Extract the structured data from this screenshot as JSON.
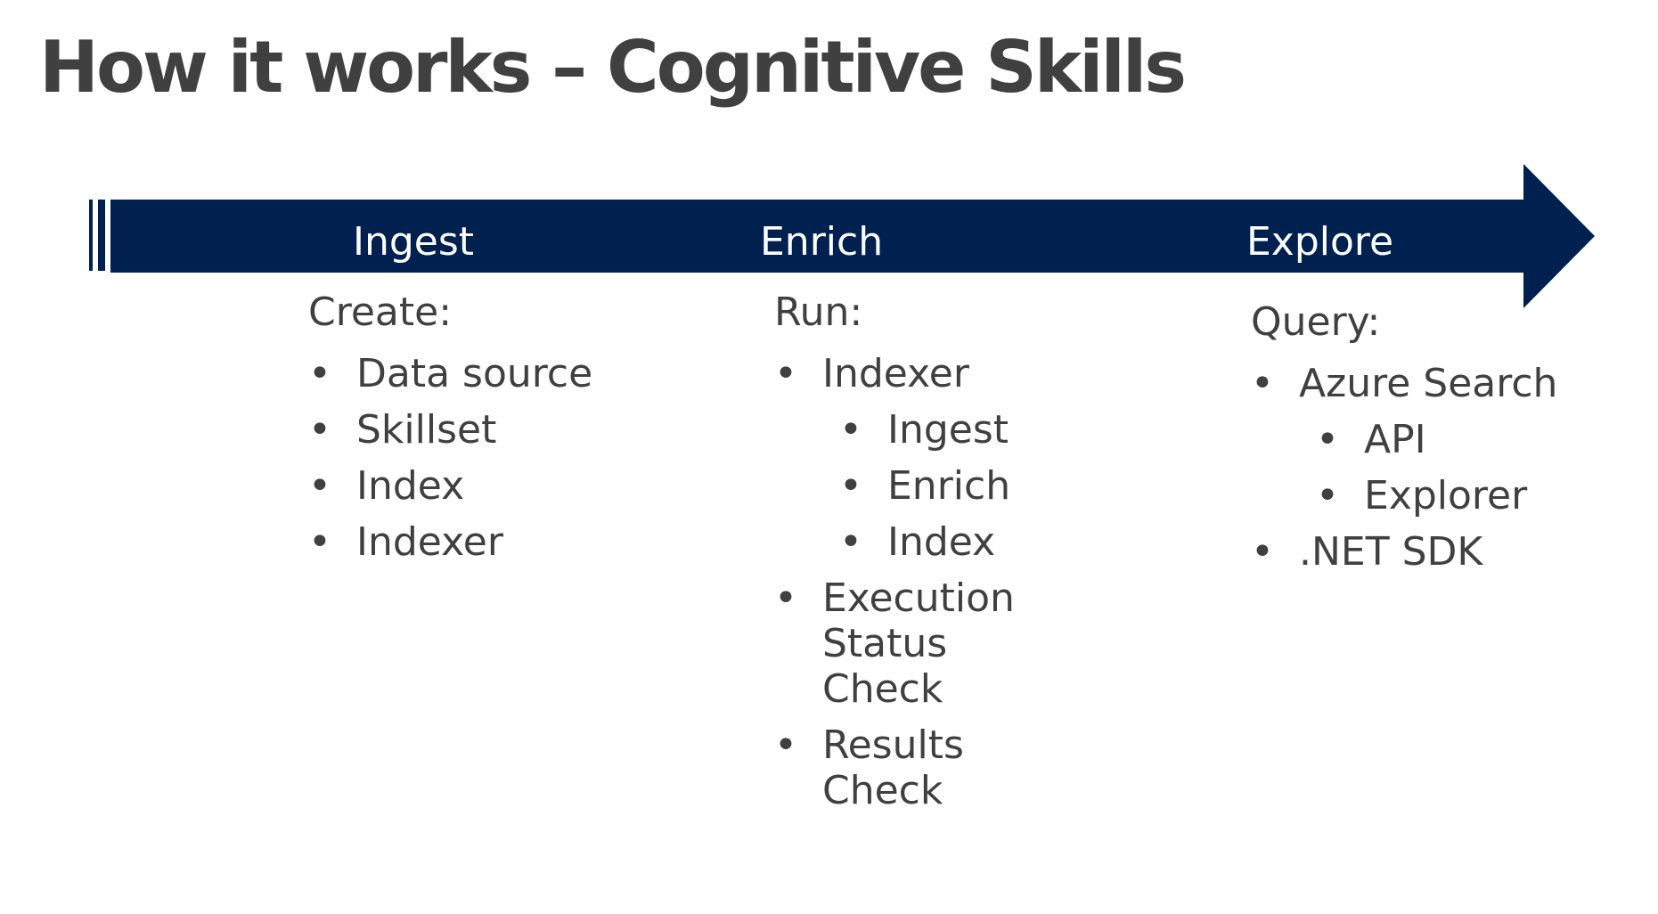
{
  "slide": {
    "title": "How it works – Cognitive Skills"
  },
  "colors": {
    "arrow": "#002050",
    "text": "#404040",
    "stage_label": "#ffffff"
  },
  "stages": [
    {
      "label": "Ingest",
      "heading": "Create:",
      "items": [
        {
          "text": "Data source",
          "level": 1
        },
        {
          "text": "Skillset",
          "level": 1
        },
        {
          "text": "Index",
          "level": 1
        },
        {
          "text": "Indexer",
          "level": 1
        }
      ]
    },
    {
      "label": "Enrich",
      "heading": "Run:",
      "items": [
        {
          "text": "Indexer",
          "level": 1
        },
        {
          "text": "Ingest",
          "level": 2
        },
        {
          "text": "Enrich",
          "level": 2
        },
        {
          "text": "Index",
          "level": 2
        },
        {
          "text": "Execution Status Check",
          "level": 1
        },
        {
          "text": "Results Check",
          "level": 1
        }
      ]
    },
    {
      "label": "Explore",
      "heading": "Query:",
      "items": [
        {
          "text": "Azure Search",
          "level": 1
        },
        {
          "text": "API",
          "level": 2
        },
        {
          "text": "Explorer",
          "level": 2
        },
        {
          "text": ".NET SDK",
          "level": 1
        }
      ]
    }
  ]
}
